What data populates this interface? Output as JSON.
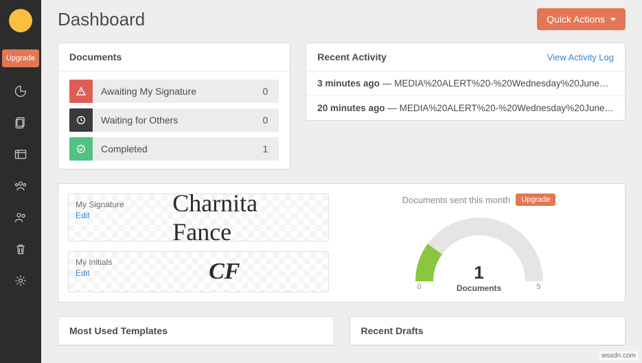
{
  "sidebar": {
    "upgrade_label": "Upgrade"
  },
  "header": {
    "title": "Dashboard",
    "quick_actions": "Quick Actions"
  },
  "documents": {
    "title": "Documents",
    "rows": [
      {
        "label": "Awaiting My Signature",
        "count": "0"
      },
      {
        "label": "Waiting for Others",
        "count": "0"
      },
      {
        "label": "Completed",
        "count": "1"
      }
    ]
  },
  "activity": {
    "title": "Recent Activity",
    "view_log": "View Activity Log",
    "items": [
      {
        "time": "3 minutes ago",
        "sep": " — ",
        "text": "MEDIA%20ALERT%20-%20Wednesday%20June…"
      },
      {
        "time": "20 minutes ago",
        "sep": " — ",
        "text": "MEDIA%20ALERT%20-%20Wednesday%20June…"
      }
    ]
  },
  "signature": {
    "sig_label": "My Signature",
    "sig_edit": "Edit",
    "sig_text": "Charnita Fance",
    "init_label": "My Initials",
    "init_edit": "Edit",
    "init_text": "CF"
  },
  "gauge": {
    "title": "Documents sent this month",
    "upgrade": "Upgrade",
    "value": "1",
    "label": "Documents",
    "min": "0",
    "max": "5"
  },
  "templates": {
    "title": "Most Used Templates"
  },
  "drafts": {
    "title": "Recent Drafts"
  },
  "watermark": "wsxdn.com",
  "chart_data": {
    "type": "bar",
    "title": "Documents sent this month",
    "value": 1,
    "min": 0,
    "max": 5,
    "label": "Documents"
  }
}
